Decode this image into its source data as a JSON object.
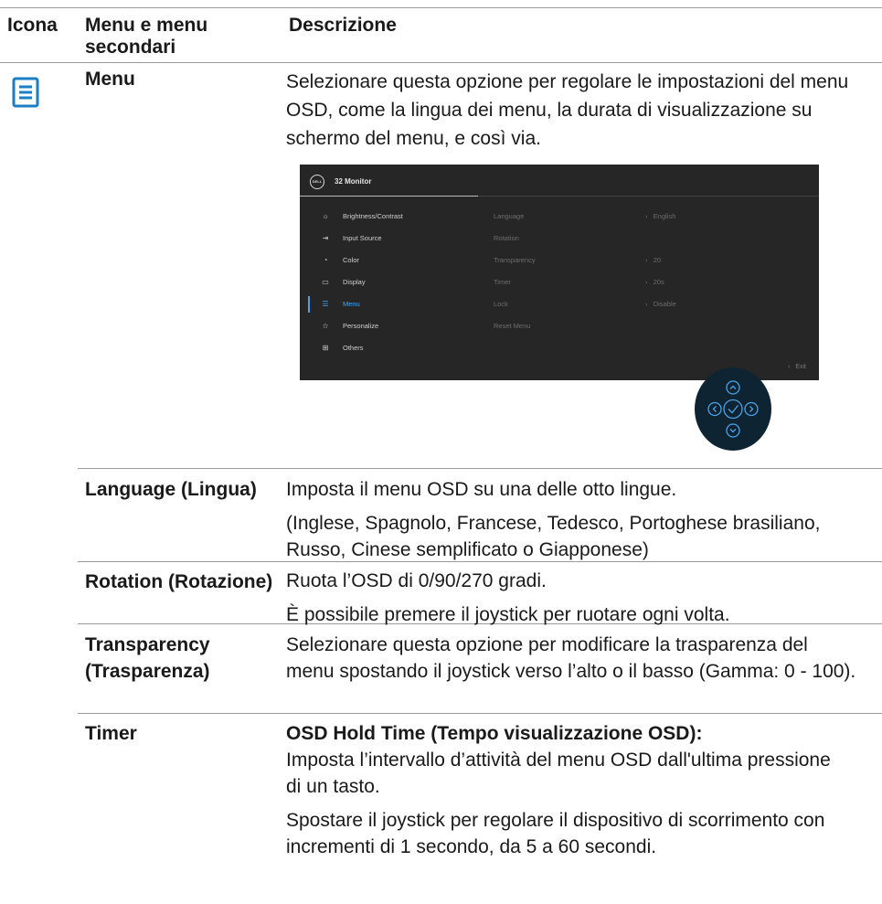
{
  "header": {
    "col_icon": "Icona",
    "col_menu": "Menu e menu secondari",
    "col_desc": "Descrizione"
  },
  "menu_row": {
    "icon": "menu-list-icon",
    "name": "Menu",
    "desc": "Selezionare questa opzione per regolare le impostazioni del menu OSD, come la lingua dei menu, la durata di visualizzazione su schermo del menu, e così via."
  },
  "osd": {
    "logo": "DELL",
    "title": "32 Monitor",
    "items": [
      {
        "icon": "brightness-icon",
        "glyph": "☼",
        "label": "Brightness/Contrast"
      },
      {
        "icon": "input-source-icon",
        "glyph": "⇥",
        "label": "Input Source"
      },
      {
        "icon": "color-icon",
        "glyph": "◔",
        "label": "Color"
      },
      {
        "icon": "display-icon",
        "glyph": "▭",
        "label": "Display"
      },
      {
        "icon": "menu-icon",
        "glyph": "☰",
        "label": "Menu"
      },
      {
        "icon": "star-icon",
        "glyph": "☆",
        "label": "Personalize"
      },
      {
        "icon": "others-icon",
        "glyph": "⊞",
        "label": "Others"
      }
    ],
    "selected": "Menu",
    "submenu": [
      {
        "label": "Language",
        "value": "English"
      },
      {
        "label": "Rotation",
        "value": ""
      },
      {
        "label": "Transparency",
        "value": "20"
      },
      {
        "label": "Timer",
        "value": "20s"
      },
      {
        "label": "Lock",
        "value": "Disable"
      },
      {
        "label": "Reset Menu",
        "value": ""
      }
    ],
    "exit": "Exit",
    "accent": "#4aa3e8"
  },
  "rows": [
    {
      "name": "Language (Lingua)",
      "desc": [
        "Imposta il menu OSD su una delle otto lingue.",
        "(Inglese, Spagnolo, Francese, Tedesco, Portoghese brasiliano, Russo, Cinese semplificato o Giapponese)"
      ]
    },
    {
      "name": "Rotation (Rotazione)",
      "desc": [
        "Ruota l’OSD di 0/90/270 gradi.",
        "È possibile premere il joystick per ruotare ogni volta."
      ]
    },
    {
      "name": "Transparency (Trasparenza)",
      "desc": [
        "Selezionare questa opzione per modificare la trasparenza del menu spostando il joystick verso l’alto o il basso (Gamma: 0 - 100)."
      ]
    },
    {
      "name": "Timer",
      "desc_bold": "OSD Hold Time (Tempo visualizzazione OSD):",
      "desc": [
        "Imposta l’intervallo d’attività del menu OSD dall'ultima pressione di un tasto.",
        "Spostare il joystick per regolare il dispositivo di scorrimento con incrementi di 1 secondo, da 5 a 60 secondi."
      ]
    }
  ]
}
